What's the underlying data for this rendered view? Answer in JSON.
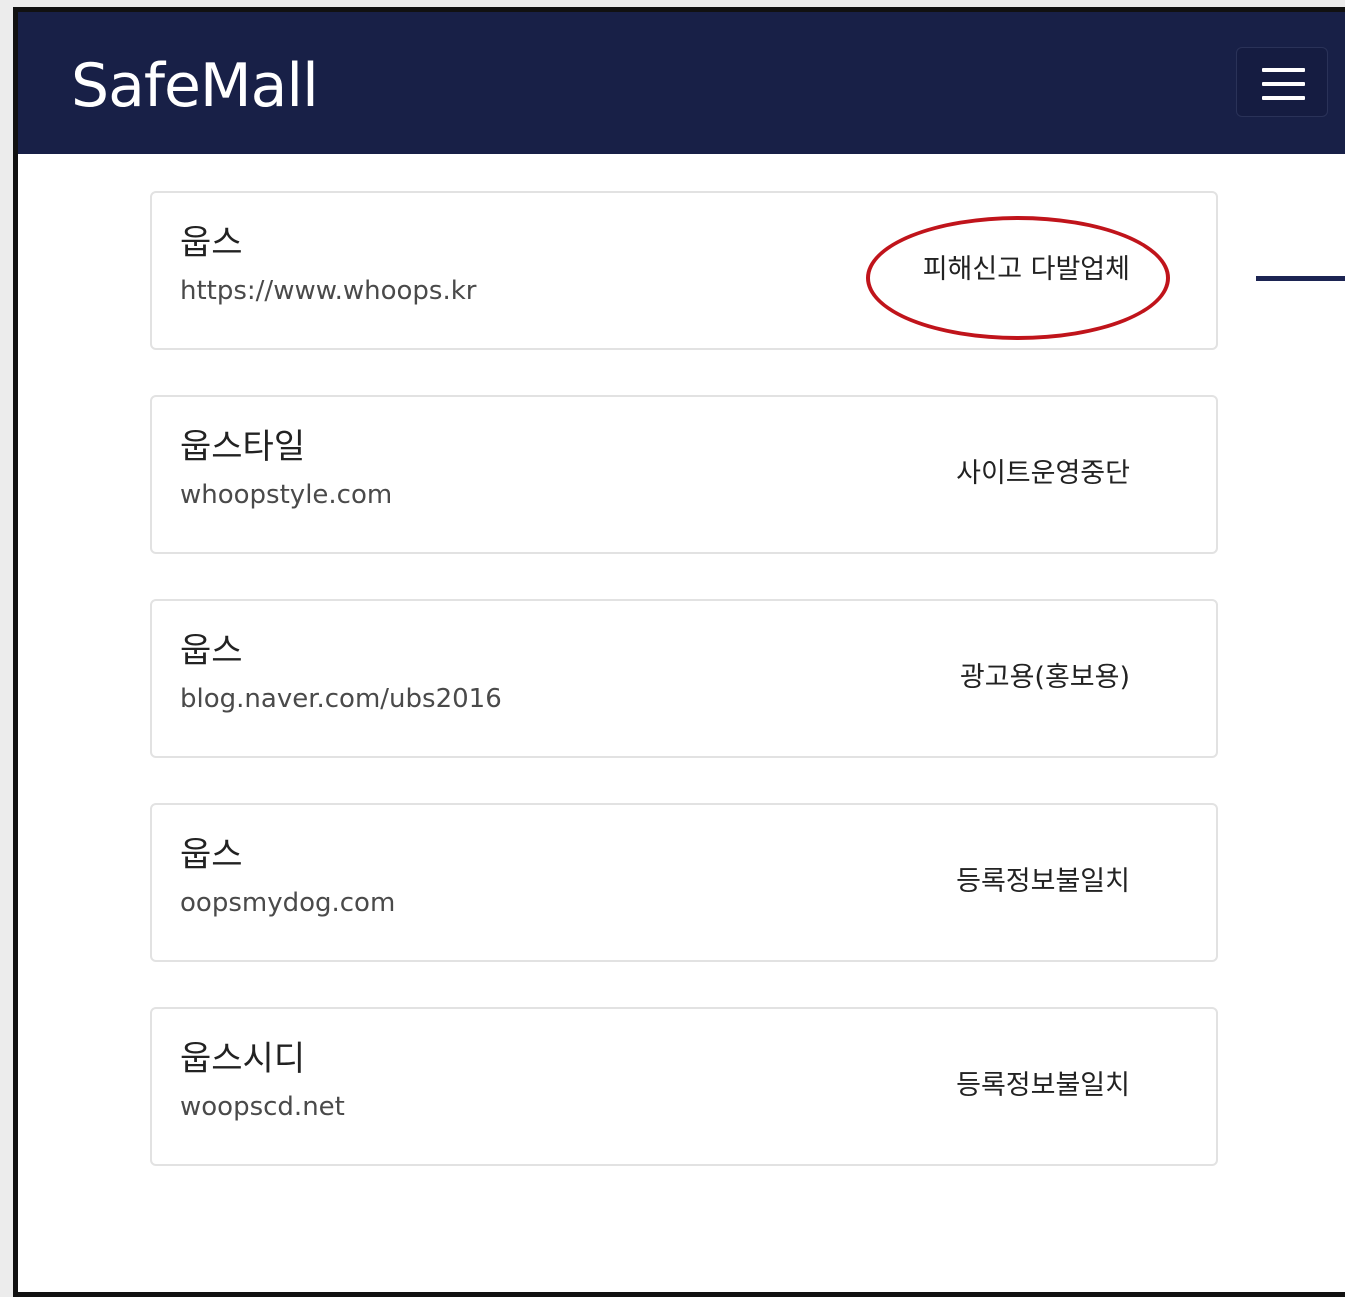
{
  "app": {
    "brand": "SafeMall",
    "menu_icon": "hamburger-menu-icon",
    "nav_color": "#182047"
  },
  "results": [
    {
      "name": "웁스",
      "url": "https://www.whoops.kr",
      "status": "피해신고 다발업체",
      "highlighted": true
    },
    {
      "name": "웁스타일",
      "url": "whoopstyle.com",
      "status": "사이트운영중단",
      "highlighted": false
    },
    {
      "name": "웁스",
      "url": "blog.naver.com/ubs2016",
      "status": "광고용(홍보용)",
      "highlighted": false
    },
    {
      "name": "웁스",
      "url": "oopsmydog.com",
      "status": "등록정보불일치",
      "highlighted": false
    },
    {
      "name": "웁스시디",
      "url": "woopscd.net",
      "status": "등록정보불일치",
      "highlighted": false
    }
  ],
  "annotation": {
    "highlight_color": "#c0141b"
  }
}
